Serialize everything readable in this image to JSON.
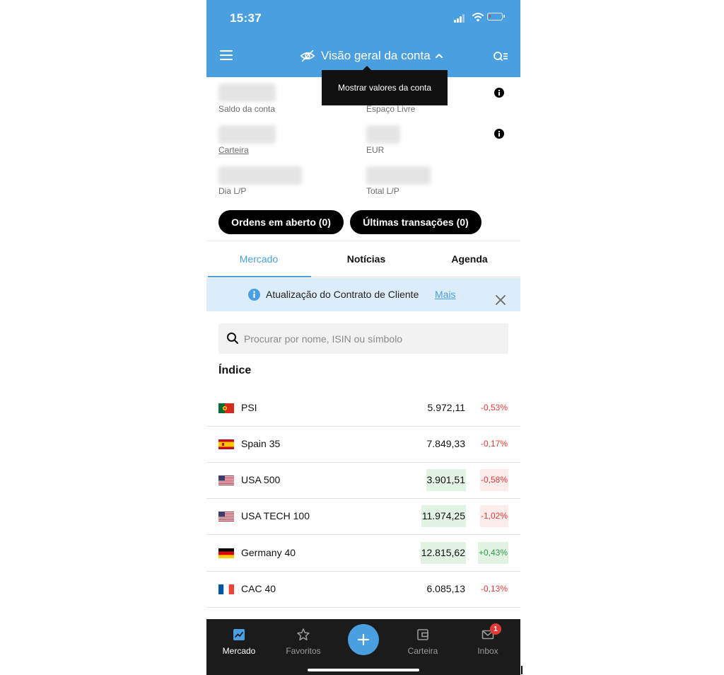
{
  "status_bar": {
    "time": "15:37"
  },
  "header": {
    "title": "Visão geral da conta",
    "tooltip": "Mostrar valores da conta"
  },
  "account": {
    "balance_label": "Saldo da conta",
    "free_space_label": "Espaço Livre",
    "portfolio_label": "Carteira",
    "currency_label": "EUR",
    "day_pl_label": "Dia L/P",
    "total_pl_label": "Total L/P"
  },
  "buttons": {
    "open_orders": "Ordens em aberto (0)",
    "last_transactions": "Últimas transações (0)"
  },
  "tabs": [
    {
      "label": "Mercado"
    },
    {
      "label": "Notícias"
    },
    {
      "label": "Agenda"
    }
  ],
  "banner": {
    "text": "Atualização do Contrato de Cliente",
    "link": "Mais"
  },
  "search": {
    "placeholder": "Procurar por nome, ISIN ou símbolo"
  },
  "section_title": "Índice",
  "indices": [
    {
      "name": "PSI",
      "value": "5.972,11",
      "change": "-0,53%",
      "flag": "portugal-flag",
      "direction": "down"
    },
    {
      "name": "Spain 35",
      "value": "7.849,33",
      "change": "-0,17%",
      "flag": "spain-flag",
      "direction": "down"
    },
    {
      "name": "USA 500",
      "value": "3.901,51",
      "change": "-0,58%",
      "flag": "usa-flag",
      "direction": "down"
    },
    {
      "name": "USA TECH 100",
      "value": "11.974,25",
      "change": "-1,02%",
      "flag": "usa-flag",
      "direction": "down"
    },
    {
      "name": "Germany 40",
      "value": "12.815,62",
      "change": "+0,43%",
      "flag": "germany-flag",
      "direction": "up"
    },
    {
      "name": "CAC 40",
      "value": "6.085,13",
      "change": "-0,13%",
      "flag": "france-flag",
      "direction": "down"
    }
  ],
  "bottom_nav": [
    {
      "label": "Mercado",
      "icon": "chart-icon"
    },
    {
      "label": "Favoritos",
      "icon": "star-icon"
    },
    {
      "label": "Carteira",
      "icon": "wallet-icon"
    },
    {
      "label": "Inbox",
      "icon": "mail-icon",
      "badge": "1"
    }
  ],
  "colors": {
    "accent": "#4a9fe0",
    "negative": "#e53935",
    "positive": "#2e9e47"
  }
}
